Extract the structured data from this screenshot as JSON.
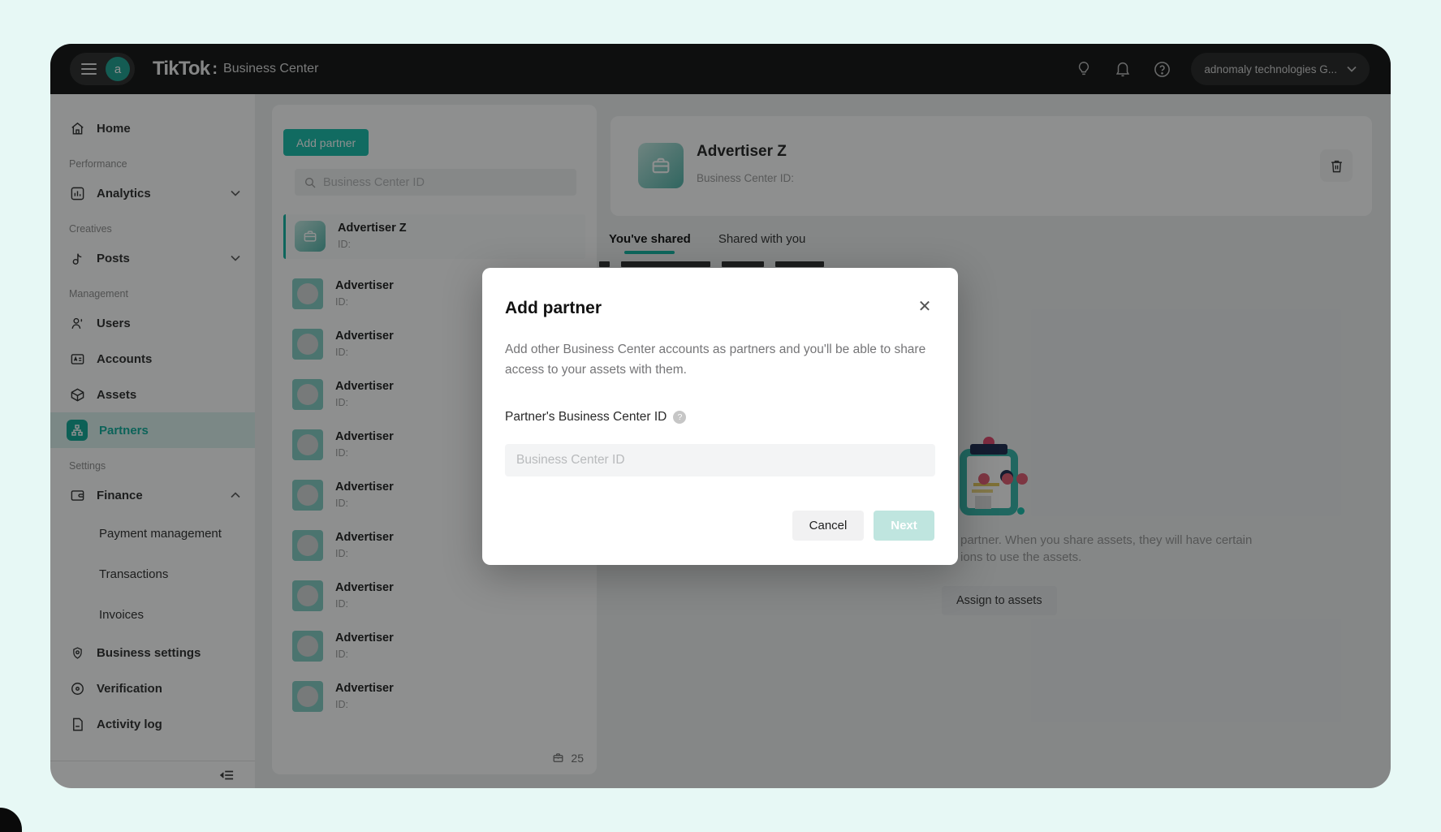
{
  "colors": {
    "accent": "#12b3a2",
    "accent_dark": "#10a896",
    "topbar_bg": "#131313",
    "canvas_bg": "#e7f8f5"
  },
  "icons": {
    "close_glyph": "✕",
    "help_glyph": "?",
    "info_glyph": "?",
    "avatar_letter_glyph": "a"
  },
  "topbar": {
    "avatar_letter": "a",
    "logo": "TikTok",
    "logo_separator": ":",
    "product": "Business Center",
    "account": "adnomaly technologies G..."
  },
  "sidebar": {
    "home": "Home",
    "sections": {
      "performance": "Performance",
      "creatives": "Creatives",
      "management": "Management",
      "settings": "Settings"
    },
    "analytics": "Analytics",
    "posts": "Posts",
    "users": "Users",
    "accounts": "Accounts",
    "assets": "Assets",
    "partners": "Partners",
    "finance": "Finance",
    "payment_management": "Payment management",
    "transactions": "Transactions",
    "invoices": "Invoices",
    "business_settings": "Business settings",
    "verification": "Verification",
    "activity_log": "Activity log"
  },
  "partners_panel": {
    "add_button": "Add partner",
    "search_placeholder": "Business Center ID",
    "selected": {
      "name": "Advertiser Z",
      "id_label": "ID:"
    },
    "rows": [
      {
        "name": "Advertiser",
        "id_label": "ID:"
      },
      {
        "name": "Advertiser",
        "id_label": "ID:"
      },
      {
        "name": "Advertiser",
        "id_label": "ID:"
      },
      {
        "name": "Advertiser",
        "id_label": "ID:"
      },
      {
        "name": "Advertiser",
        "id_label": "ID:"
      },
      {
        "name": "Advertiser",
        "id_label": "ID:"
      },
      {
        "name": "Advertiser",
        "id_label": "ID:"
      },
      {
        "name": "Advertiser",
        "id_label": "ID:"
      },
      {
        "name": "Advertiser",
        "id_label": "ID:"
      }
    ],
    "count": "25"
  },
  "detail": {
    "title": "Advertiser Z",
    "subtitle": "Business Center ID:",
    "tab_shared": "You've shared",
    "tab_shared_with_you": "Shared with you",
    "empty_state": {
      "line1_fragment": "partner. When you share assets, they will have certain",
      "line2_fragment": "ions to use the assets.",
      "assign_button": "Assign to assets"
    }
  },
  "modal": {
    "title": "Add partner",
    "description": "Add other Business Center accounts as partners and you'll be able to share access to your assets with them.",
    "field_label": "Partner's Business Center ID",
    "input_placeholder": "Business Center ID",
    "cancel": "Cancel",
    "next": "Next"
  }
}
